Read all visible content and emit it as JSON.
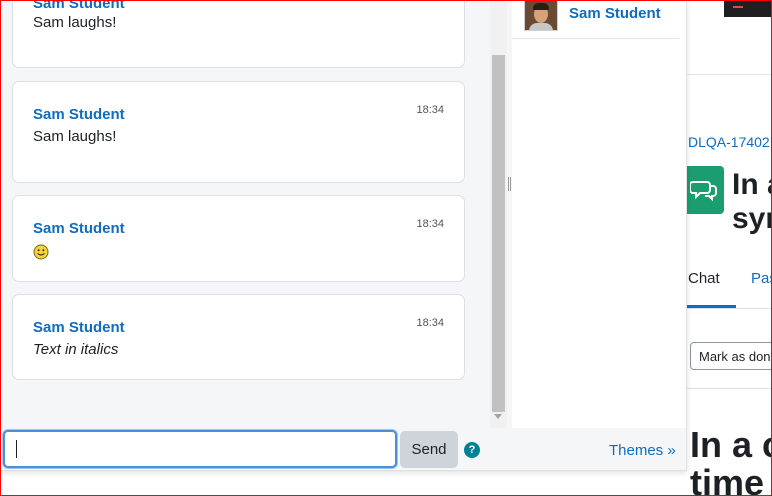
{
  "colors": {
    "link_blue": "#0f6cbf",
    "help_teal": "#008196",
    "activity_green": "#1a9e6f",
    "frame_red": "#ff0000"
  },
  "chat": {
    "messages": [
      {
        "name": "Sam Student",
        "time": "",
        "text": "Sam laughs!"
      },
      {
        "name": "Sam Student",
        "time": "18:34",
        "text": "Sam laughs!"
      },
      {
        "name": "Sam Student",
        "time": "18:34",
        "text": "",
        "emoticon": "smiley-icon"
      },
      {
        "name": "Sam Student",
        "time": "18:34",
        "text": "Text in italics",
        "italic": true
      }
    ]
  },
  "users": [
    {
      "name": "Sam Student",
      "avatar": "user-avatar"
    }
  ],
  "input": {
    "value": "",
    "placeholder": ""
  },
  "send_label": "Send",
  "help_icon": "?",
  "themes_label": "Themes »",
  "background_page": {
    "breadcrumb": "DLQA-17402",
    "title_fragment_1": "In a",
    "title_fragment_2": "syn",
    "tab_chat": "Chat",
    "tab_past": "Pas",
    "mark_as_done": "Mark as don",
    "heading_fragment_1": "In a c",
    "heading_fragment_2": "time"
  }
}
